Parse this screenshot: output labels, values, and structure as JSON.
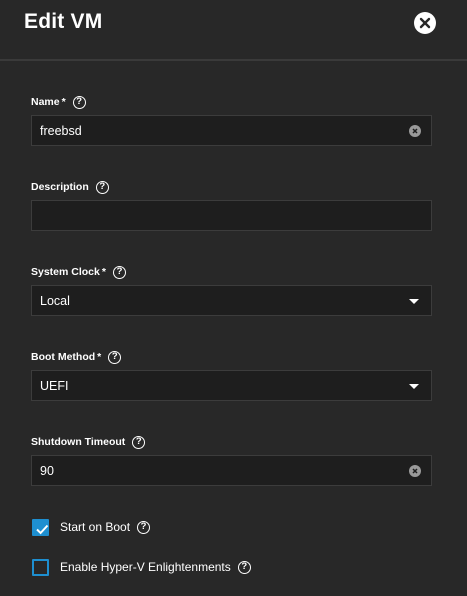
{
  "dialog": {
    "title": "Edit VM",
    "close_icon": "close-icon"
  },
  "fields": {
    "name": {
      "label": "Name",
      "required": "*",
      "value": "freebsd"
    },
    "description": {
      "label": "Description",
      "value": ""
    },
    "system_clock": {
      "label": "System Clock",
      "required": "*",
      "selected": "Local"
    },
    "boot_method": {
      "label": "Boot Method",
      "required": "*",
      "selected": "UEFI"
    },
    "shutdown_timeout": {
      "label": "Shutdown Timeout",
      "value": "90"
    }
  },
  "checkboxes": {
    "start_on_boot": {
      "label": "Start on Boot",
      "checked": true
    },
    "hyperv": {
      "label": "Enable Hyper-V Enlightenments",
      "checked": false
    }
  },
  "help_glyph": "?",
  "colors": {
    "background": "#282828",
    "input_bg": "#1e1e1e",
    "accent": "#1e8fd0"
  }
}
